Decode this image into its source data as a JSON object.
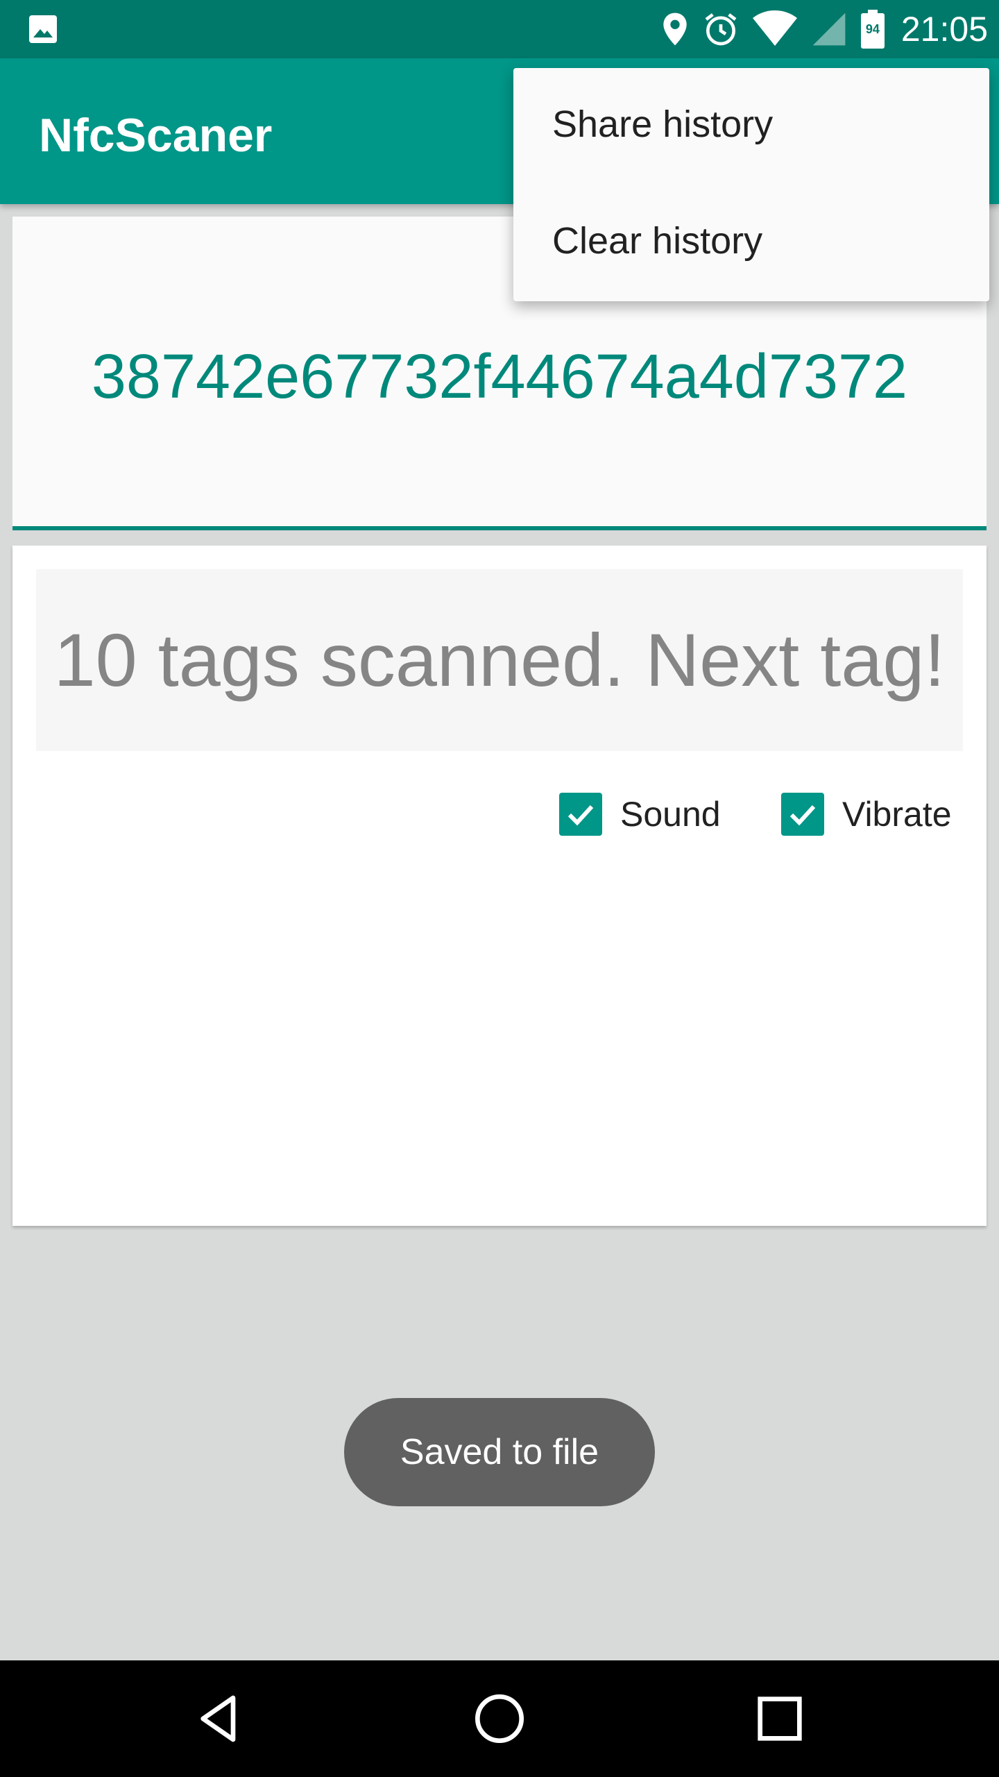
{
  "status_bar": {
    "time": "21:05",
    "battery_level": "94",
    "icons": [
      "gallery-icon",
      "location-icon",
      "alarm-icon",
      "wifi-icon",
      "signal-icon",
      "battery-icon"
    ]
  },
  "app_bar": {
    "title": "NfcScaner"
  },
  "menu": {
    "items": [
      {
        "label": "Share history"
      },
      {
        "label": "Clear history"
      }
    ]
  },
  "tag": {
    "id": "38742e67732f44674a4d7372"
  },
  "scan_status": {
    "text": "10 tags scanned. Next tag!"
  },
  "options": {
    "sound": {
      "label": "Sound",
      "checked": true
    },
    "vibrate": {
      "label": "Vibrate",
      "checked": true
    }
  },
  "toast": {
    "text": "Saved to file"
  },
  "nav": {
    "icons": [
      "back-icon",
      "home-icon",
      "recents-icon"
    ]
  },
  "colors": {
    "primary": "#009688",
    "primary_dark": "#00796b",
    "accent": "#00897b"
  }
}
